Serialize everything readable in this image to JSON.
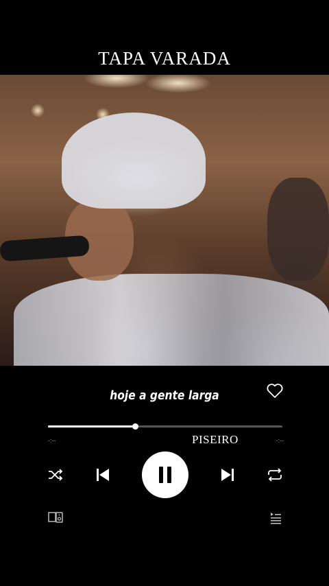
{
  "header": {
    "title": "TAPA VARADA"
  },
  "player": {
    "lyric_line": "hoje a gente larga",
    "genre_label": "PISEIRO",
    "time_elapsed": "-:--",
    "time_remaining": "-:--",
    "progress": 0.37
  },
  "icons": {
    "like": "heart-icon",
    "shuffle": "shuffle-icon",
    "previous": "skip-previous-icon",
    "play_pause": "pause-icon",
    "next": "skip-next-icon",
    "repeat": "repeat-icon",
    "devices": "connect-device-icon",
    "queue": "queue-icon"
  },
  "colors": {
    "background": "#000000",
    "accent": "#ffffff",
    "track": "#555555"
  }
}
